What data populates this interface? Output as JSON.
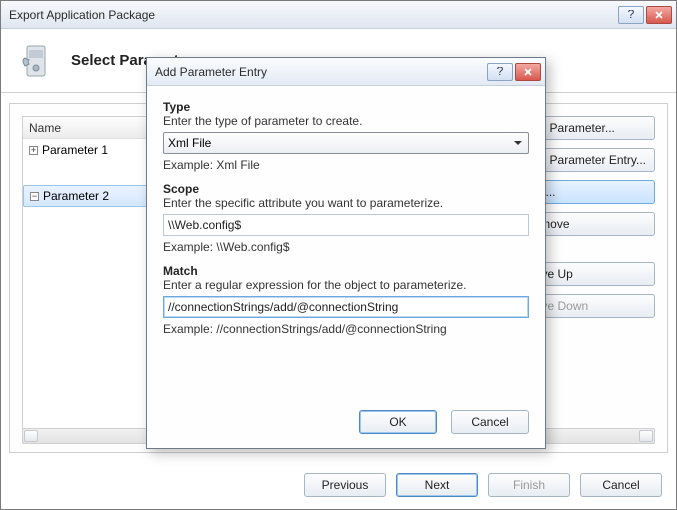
{
  "outerWindow": {
    "title": "Export Application Package",
    "bannerTitle": "Select Parameters"
  },
  "paramsTable": {
    "header": "Name",
    "rows": [
      "Parameter 1",
      "Parameter 2"
    ],
    "selectedIndex": 1
  },
  "sideButtons": {
    "addParameter": "Add Parameter...",
    "addParameterEntry": "Add Parameter Entry...",
    "edit": "Edit...",
    "remove": "Remove",
    "moveUp": "Move Up",
    "moveDown": "Move Down"
  },
  "footerButtons": {
    "previous": "Previous",
    "next": "Next",
    "finish": "Finish",
    "cancel": "Cancel"
  },
  "modal": {
    "title": "Add Parameter Entry",
    "type": {
      "head": "Type",
      "desc": "Enter the type of parameter to create.",
      "value": "Xml File",
      "example": "Example: Xml File"
    },
    "scope": {
      "head": "Scope",
      "desc": "Enter the specific attribute you want to parameterize.",
      "value": "\\\\Web.config$",
      "example": "Example: \\\\Web.config$"
    },
    "match": {
      "head": "Match",
      "desc": "Enter a regular expression for the object to parameterize.",
      "value": "//connectionStrings/add/@connectionString",
      "example": "Example: //connectionStrings/add/@connectionString"
    },
    "buttons": {
      "ok": "OK",
      "cancel": "Cancel"
    }
  }
}
